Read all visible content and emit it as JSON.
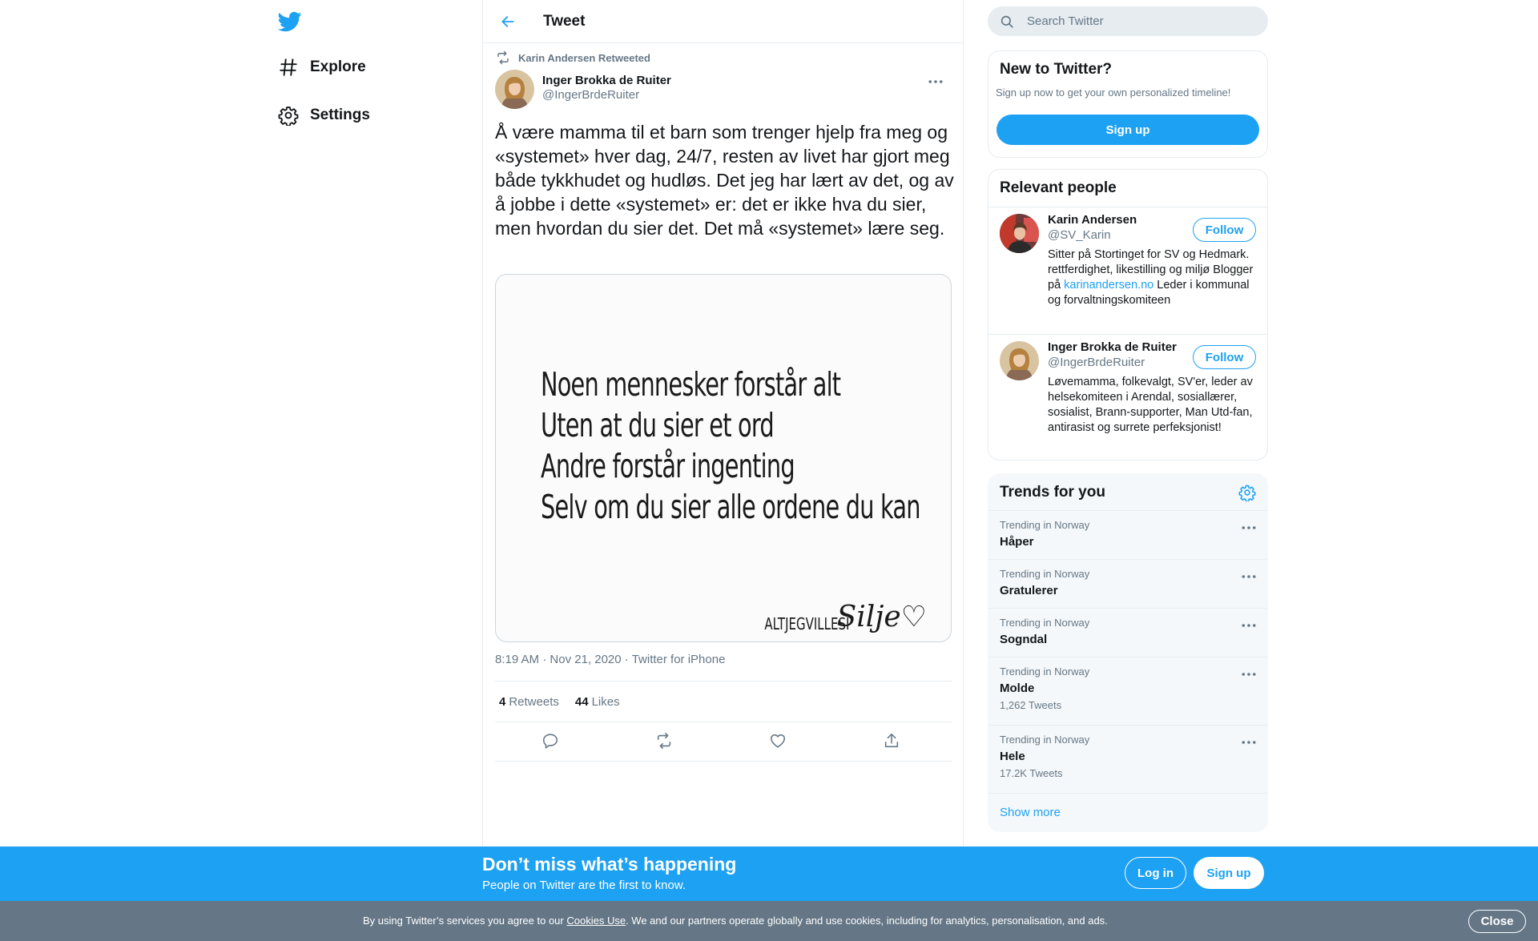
{
  "nav": {
    "logo_icon": "twitter-bird-icon",
    "items": [
      {
        "label": "Explore",
        "icon": "hashtag-icon"
      },
      {
        "label": "Settings",
        "icon": "gear-icon"
      }
    ]
  },
  "header": {
    "title": "Tweet",
    "back_icon": "arrow-left-icon"
  },
  "tweet": {
    "retweet_context": "Karin Andersen Retweeted",
    "author_name": "Inger Brokka de Ruiter",
    "author_handle": "@IngerBrdeRuiter",
    "text": "Å være mamma til et barn som trenger hjelp fra meg og «systemet» hver dag, 24/7, resten av livet har gjort meg både tykkhudet og hudløs. Det jeg har lært av det, og av å jobbe i dette «systemet» er: det er ikke hva du sier, men hvordan du sier det. Det må «systemet» lære seg.",
    "image_lines": [
      "Noen mennesker forstår alt",
      "Uten at du sier et ord",
      "Andre forstår ingenting",
      "Selv om du sier alle ordene du kan"
    ],
    "image_signature_caps": "ALTJEGVILLESI",
    "image_signature_script": "Silje♡",
    "time": "8:19 AM",
    "separator": "·",
    "date": "Nov 21, 2020",
    "source": "Twitter for iPhone",
    "retweets_count": "4",
    "retweets_label": "Retweets",
    "likes_count": "44",
    "likes_label": "Likes"
  },
  "search": {
    "placeholder": "Search Twitter"
  },
  "signup_card": {
    "title": "New to Twitter?",
    "subtitle": "Sign up now to get your own personalized timeline!",
    "button": "Sign up"
  },
  "relevant_people": {
    "title": "Relevant people",
    "people": [
      {
        "name": "Karin Andersen",
        "handle": "@SV_Karin",
        "follow": "Follow",
        "bio_before_link": "Sitter på Stortinget for SV og Hedmark. rettferdighet, likestilling og miljø Blogger på ",
        "bio_link": "karinandersen.no",
        "bio_after_link": " Leder i kommunal og forvaltningskomiteen"
      },
      {
        "name": "Inger Brokka de Ruiter",
        "handle": "@IngerBrdeRuiter",
        "follow": "Follow",
        "bio": "Løvemamma, folkevalgt, SV'er, leder av helsekomiteen i Arendal, sosiallærer, sosialist, Brann-supporter, Man Utd-fan, antirasist og surrete perfeksjonist!"
      }
    ]
  },
  "trends": {
    "title": "Trends for you",
    "items": [
      {
        "context": "Trending in Norway",
        "name": "Håper",
        "count": ""
      },
      {
        "context": "Trending in Norway",
        "name": "Gratulerer",
        "count": ""
      },
      {
        "context": "Trending in Norway",
        "name": "Sogndal",
        "count": ""
      },
      {
        "context": "Trending in Norway",
        "name": "Molde",
        "count": "1,262 Tweets"
      },
      {
        "context": "Trending in Norway",
        "name": "Hele",
        "count": "17.2K Tweets"
      }
    ],
    "show_more": "Show more"
  },
  "banner": {
    "heading": "Don’t miss what’s happening",
    "subheading": "People on Twitter are the first to know.",
    "login": "Log in",
    "signup": "Sign up"
  },
  "cookie": {
    "text_before": "By using Twitter’s services you agree to our ",
    "link": "Cookies Use",
    "text_after": ". We and our partners operate globally and use cookies, including for analytics, personalisation, and ads.",
    "close": "Close"
  },
  "colors": {
    "accent": "#1da1f2",
    "text": "#14171a",
    "secondary_text": "#657786",
    "border": "#e6ecf0",
    "cookie_bar": "#657786"
  }
}
